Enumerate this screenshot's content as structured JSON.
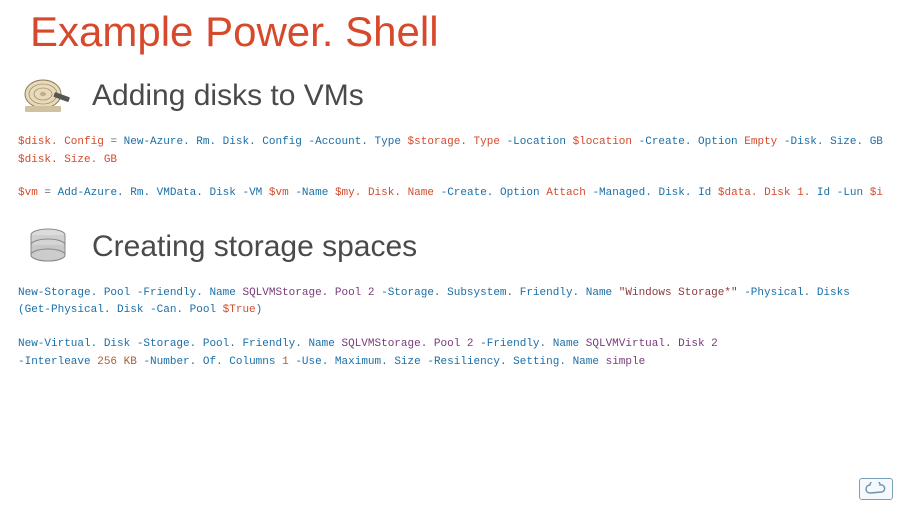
{
  "slide": {
    "title": "Example Power. Shell"
  },
  "sections": {
    "adding_disks": {
      "title": "Adding disks to VMs",
      "icon": "harddisk-icon",
      "code1": {
        "lhs_var": "$disk. Config",
        "eq": "=",
        "cmd": "New-Azure. Rm. Disk. Config",
        "p1": "-Account. Type",
        "v1": "$storage. Type",
        "p2": "-Location",
        "v2": "$location",
        "p3": "-Create. Option",
        "v3": "Empty",
        "p4": "-Disk. Size. GB",
        "v4": "$disk. Size. GB"
      },
      "code2": {
        "lhs_var": "$vm",
        "eq": "=",
        "cmd": "Add-Azure. Rm. VMData. Disk",
        "p1": "-VM",
        "v1": "$vm",
        "p2": "-Name",
        "v2": "$my. Disk. Name",
        "p3": "-Create. Option",
        "v3": "Attach",
        "p4": "-Managed. Disk. Id",
        "v4": "$data. Disk 1.",
        "v4b": "Id",
        "p5": "-Lun",
        "v5": "$i"
      }
    },
    "storage_spaces": {
      "title": "Creating storage spaces",
      "icon": "storage-stack-icon",
      "code1": {
        "cmd": "New-Storage. Pool",
        "p1": "-Friendly. Name",
        "v1": "SQLVMStorage. Pool 2",
        "p2": "-Storage. Subsystem. Friendly. Name",
        "v2": "\"Windows Storage*\"",
        "p3": "-Physical. Disks",
        "v3a": "(Get-Physical. Disk",
        "p4": "-Can. Pool",
        "v4": "$True",
        "paren": ")"
      },
      "code2": {
        "cmd": "New-Virtual. Disk",
        "p1": "-Storage. Pool. Friendly. Name",
        "v1": "SQLVMStorage. Pool 2",
        "p2": "-Friendly. Name",
        "v2": "SQLVMVirtual. Disk 2",
        "p3": "-Interleave",
        "v3": "256 KB",
        "p4": "-Number. Of. Columns",
        "v4": "1",
        "p5": "-Use. Maximum. Size",
        "p6": "-Resiliency. Setting. Name",
        "v6": "simple"
      }
    }
  },
  "corner": {
    "logo_name": "cloud-icon"
  }
}
